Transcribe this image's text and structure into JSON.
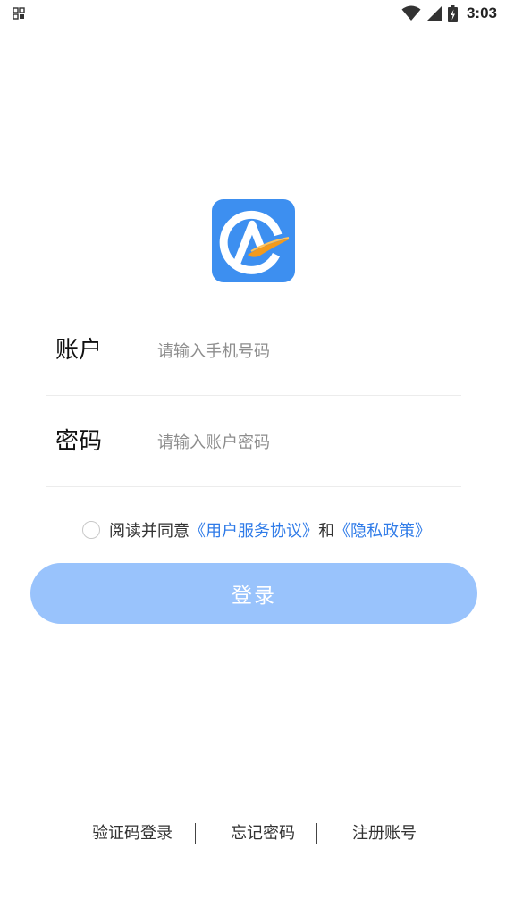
{
  "status_bar": {
    "time": "3:03",
    "icons": [
      "notification-grid-icon",
      "wifi-icon",
      "cell-signal-icon",
      "battery-charging-icon"
    ]
  },
  "logo": {
    "icon": "app-logo-icon",
    "colors": {
      "background": "#3d8ff0",
      "mark": "#ffffff",
      "swoosh": "#f39a1c"
    }
  },
  "form": {
    "account": {
      "label": "账户",
      "placeholder": "请输入手机号码",
      "value": ""
    },
    "password": {
      "label": "密码",
      "placeholder": "请输入账户密码",
      "value": ""
    }
  },
  "agreement": {
    "checked": false,
    "prefix": "阅读并同意",
    "user_agreement": "《用户服务协议》",
    "conjunction": "和",
    "privacy_policy": "《隐私政策》",
    "link_color": "#2f7be8"
  },
  "login_button": {
    "label": "登录",
    "color": "#99c3fc"
  },
  "bottom_links": {
    "sms_login": "验证码登录",
    "forgot_password": "忘记密码",
    "register": "注册账号"
  }
}
